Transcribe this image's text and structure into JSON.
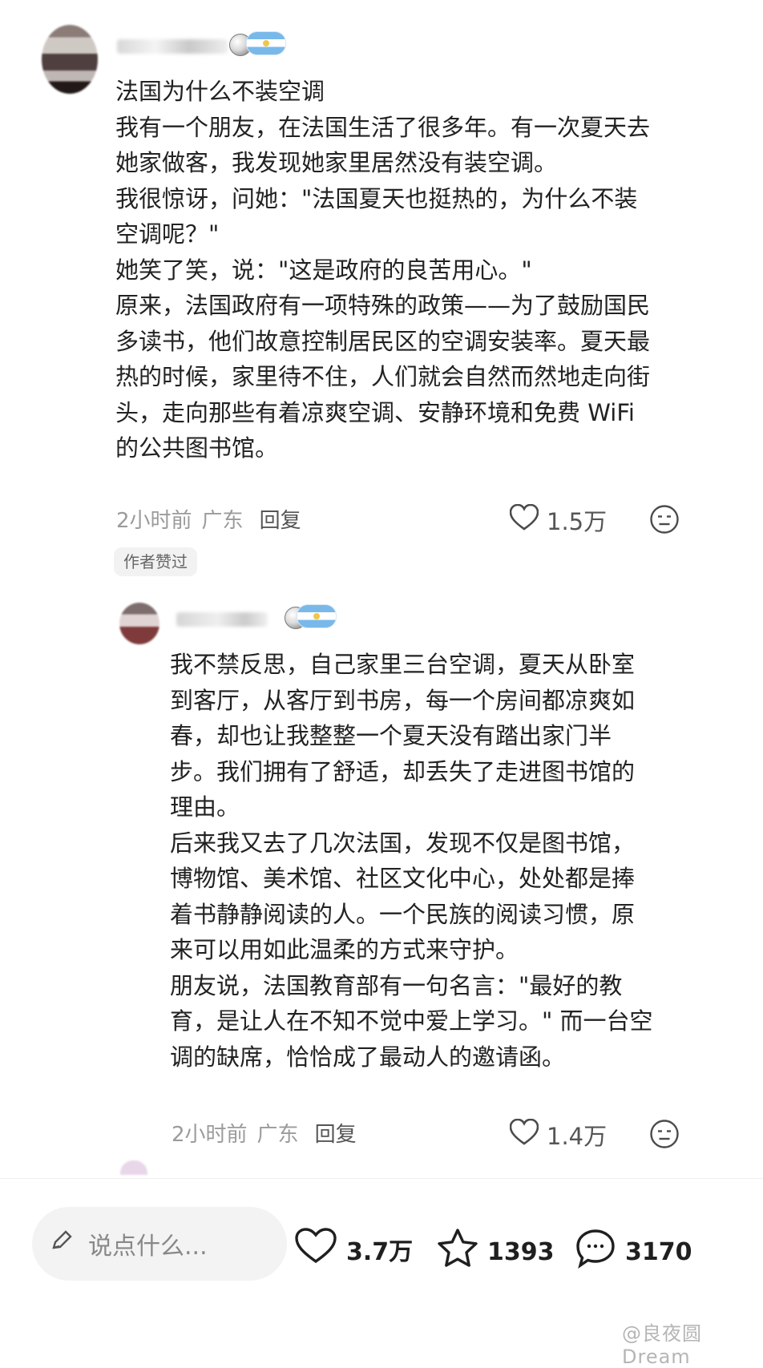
{
  "comment": {
    "lines": "法国为什么不装空调\n我有一个朋友，在法国生活了很多年。有一次夏天去\n她家做客，我发现她家里居然没有装空调。\n我很惊讶，问她：\"法国夏天也挺热的，为什么不装\n空调呢？\"\n她笑了笑，说：\"这是政府的良苦用心。\"\n原来，法国政府有一项特殊的政策——为了鼓励国民\n多读书，他们故意控制居民区的空调安装率。夏天最\n热的时候，家里待不住，人们就会自然而然地走向街\n头，走向那些有着凉爽空调、安静环境和免费 WiFi\n的公共图书馆。",
    "time": "2小时前",
    "location": "广东",
    "reply_label": "回复",
    "likes": "1.5万",
    "author_liked": "作者赞过"
  },
  "reply": {
    "lines": "我不禁反思，自己家里三台空调，夏天从卧室\n到客厅，从客厅到书房，每一个房间都凉爽如\n春，却也让我整整一个夏天没有踏出家门半\n步。我们拥有了舒适，却丢失了走进图书馆的\n理由。\n后来我又去了几次法国，发现不仅是图书馆，\n博物馆、美术馆、社区文化中心，处处都是捧\n着书静静阅读的人。一个民族的阅读习惯，原\n来可以用如此温柔的方式来守护。\n朋友说，法国教育部有一句名言：\"最好的教\n育，是让人在不知不觉中爱上学习。\" 而一台空\n调的缺席，恰恰成了最动人的邀请函。",
    "time": "2小时前",
    "location": "广东",
    "reply_label": "回复",
    "likes": "1.4万"
  },
  "bottom_bar": {
    "input_placeholder": "说点什么...",
    "likes": "3.7万",
    "favorites": "1393",
    "comments": "3170"
  },
  "watermark": "@良夜圆Dream",
  "icons": {
    "heart": "heart-icon",
    "smile": "smile-icon",
    "star": "star-icon",
    "comment": "comment-icon",
    "pencil": "pencil-icon",
    "flag": "argentina-flag-icon",
    "ball": "soccer-ball-icon"
  },
  "colors": {
    "text": "#222222",
    "meta": "#9b9b9b",
    "bg": "#ffffff",
    "pill_bg": "#f3f3f3"
  }
}
